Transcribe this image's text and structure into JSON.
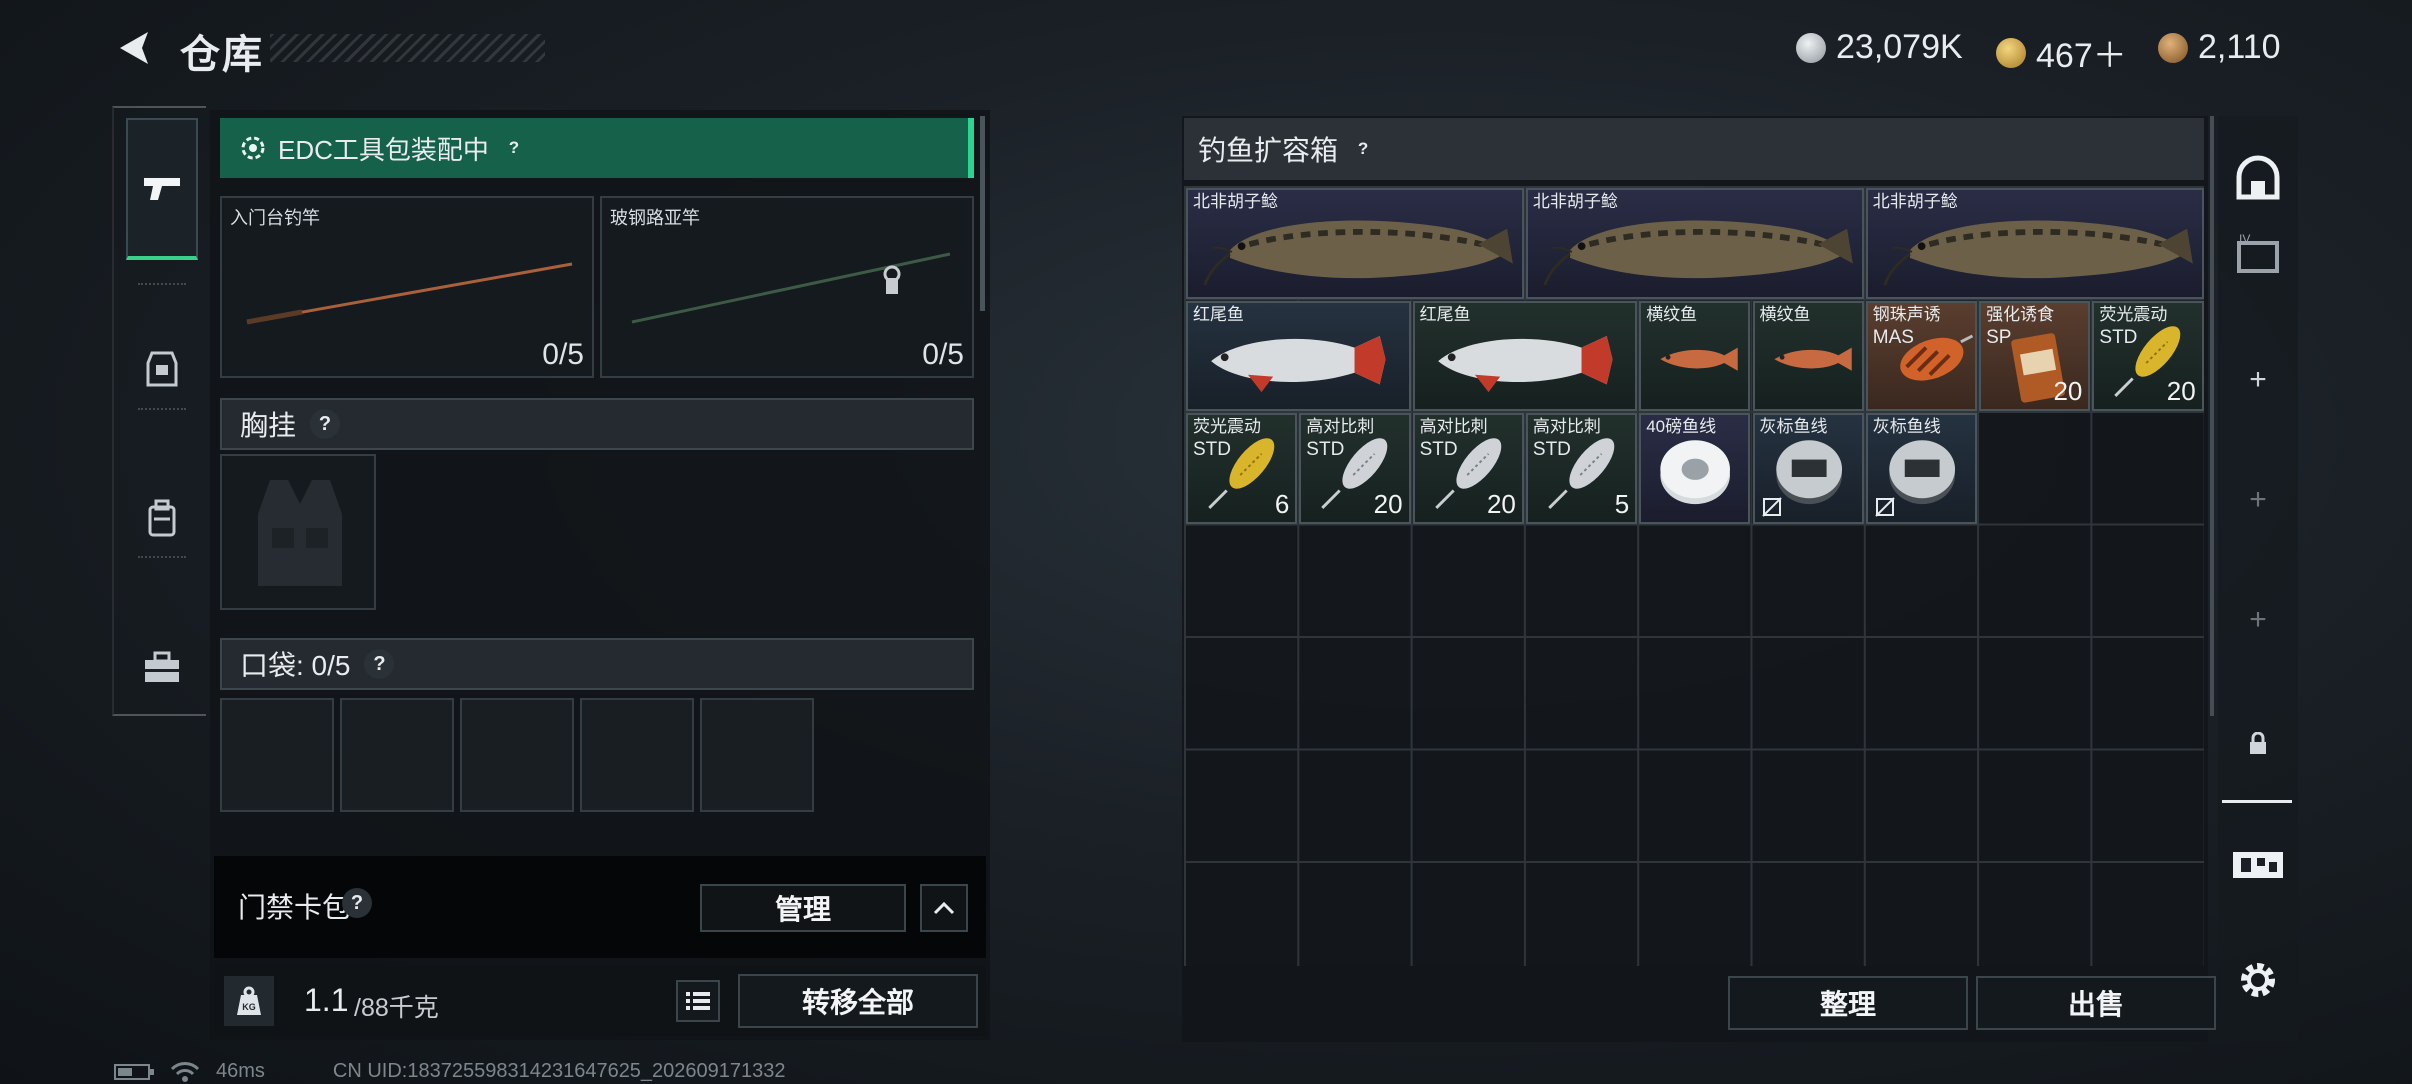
{
  "header": {
    "title": "仓库"
  },
  "currencies": [
    {
      "icon": "silver-coin-icon",
      "value": "23,079K",
      "color": "#b8bfc6"
    },
    {
      "icon": "gold-coin-icon",
      "value": "467＋",
      "color": "#c9a243"
    },
    {
      "icon": "bronze-coin-icon",
      "value": "2,110",
      "color": "#a87a45"
    }
  ],
  "left": {
    "edc_status": "EDC工具包装配中",
    "rods": [
      {
        "label": "入门台钓竿",
        "count": "0/5"
      },
      {
        "label": "玻钢路亚竿",
        "count": "0/5"
      }
    ],
    "chest_label": "胸挂",
    "pocket_label": "口袋: 0/5",
    "card_pack_label": "门禁卡包",
    "manage_label": "管理",
    "weight_value": "1.1",
    "weight_max": "/88千克",
    "transfer_all_label": "转移全部"
  },
  "container": {
    "title": "钓鱼扩容箱",
    "sort_label": "整理",
    "sell_label": "出售",
    "items": [
      {
        "name": "北非胡子鲶",
        "grade": "",
        "qty": "",
        "rarity": "purple",
        "art": "catfish"
      },
      {
        "name": "北非胡子鲶",
        "grade": "",
        "qty": "",
        "rarity": "purple",
        "art": "catfish"
      },
      {
        "name": "北非胡子鲶",
        "grade": "",
        "qty": "",
        "rarity": "purple",
        "art": "catfish"
      },
      {
        "name": "红尾鱼",
        "grade": "",
        "qty": "",
        "rarity": "steel",
        "art": "redtail"
      },
      {
        "name": "红尾鱼",
        "grade": "",
        "qty": "",
        "rarity": "green",
        "art": "redtail"
      },
      {
        "name": "横纹鱼",
        "grade": "",
        "qty": "",
        "rarity": "green",
        "art": "small"
      },
      {
        "name": "横纹鱼",
        "grade": "",
        "qty": "",
        "rarity": "green",
        "art": "small"
      },
      {
        "name": "钢珠声诱",
        "grade": "MAS",
        "qty": "",
        "rarity": "orange",
        "art": "crank"
      },
      {
        "name": "强化诱食",
        "grade": "SP",
        "qty": "20",
        "rarity": "orange",
        "art": "bait"
      },
      {
        "name": "荧光震动",
        "grade": "STD",
        "qty": "20",
        "rarity": "green",
        "art": "spoon-gold"
      },
      {
        "name": "荧光震动",
        "grade": "STD",
        "qty": "6",
        "rarity": "green",
        "art": "spoon-gold"
      },
      {
        "name": "高对比刺",
        "grade": "STD",
        "qty": "20",
        "rarity": "green",
        "art": "spoon-silver"
      },
      {
        "name": "高对比刺",
        "grade": "STD",
        "qty": "20",
        "rarity": "green",
        "art": "spoon-silver"
      },
      {
        "name": "高对比刺",
        "grade": "STD",
        "qty": "5",
        "rarity": "green",
        "art": "spoon-silver"
      },
      {
        "name": "40磅鱼线",
        "grade": "",
        "qty": "",
        "rarity": "purple",
        "art": "spool-white"
      },
      {
        "name": "灰标鱼线",
        "grade": "",
        "qty": "",
        "rarity": "steel",
        "art": "spool-grey"
      },
      {
        "name": "灰标鱼线",
        "grade": "",
        "qty": "",
        "rarity": "steel",
        "art": "spool-grey"
      }
    ]
  },
  "status": {
    "ping": "46ms",
    "uid": "CN UID:18372559831423164762​5_202609171332"
  }
}
